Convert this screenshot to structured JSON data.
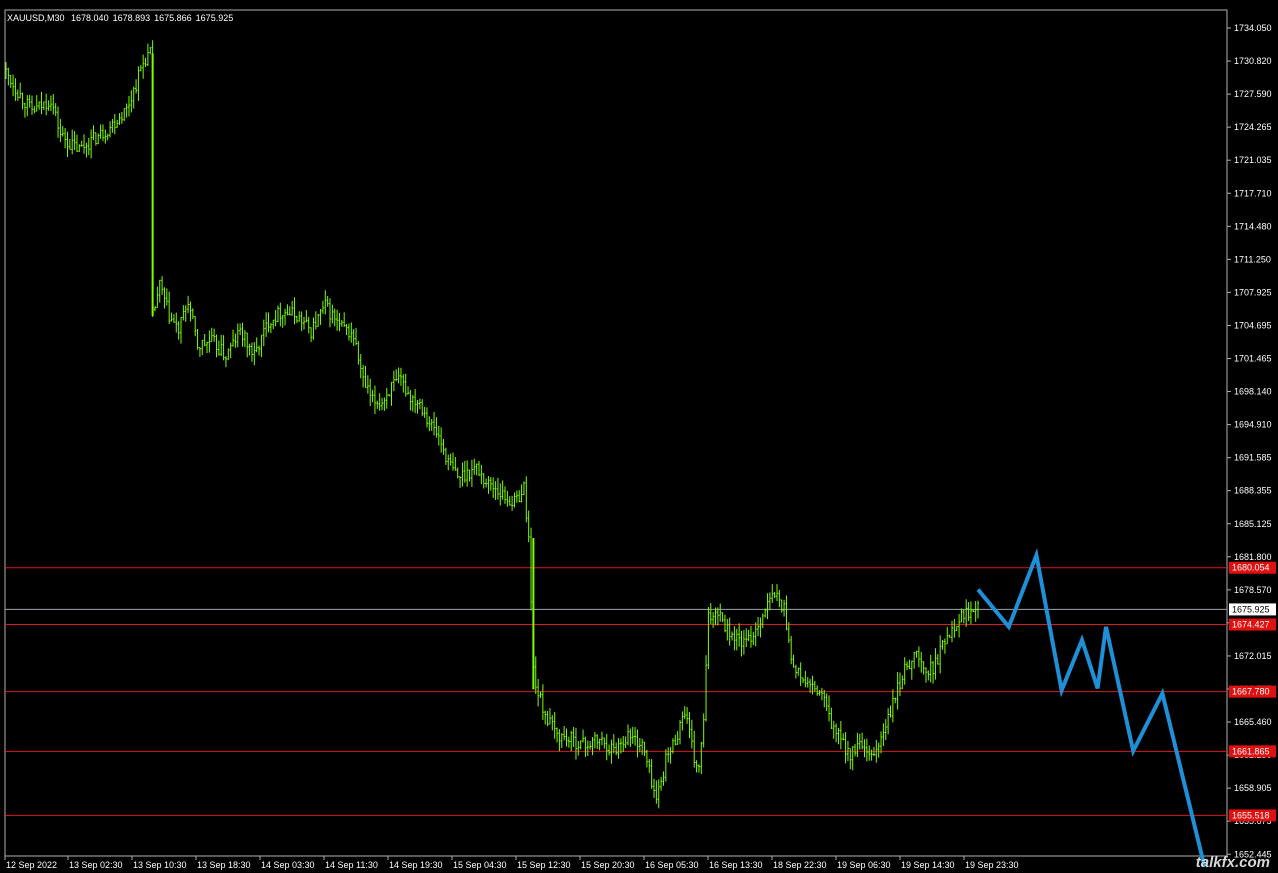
{
  "header": {
    "symbol": "XAUUSD,M30",
    "open": "1678.040",
    "high": "1678.893",
    "low": "1675.866",
    "close": "1675.925"
  },
  "watermark": "talkfx.com",
  "chart_data": {
    "type": "candlestick",
    "price_axis": {
      "ylim": [
        1651.5,
        1735.3
      ],
      "ticks": [
        "1734.050",
        "1730.820",
        "1727.590",
        "1724.265",
        "1721.035",
        "1717.710",
        "1714.480",
        "1711.250",
        "1707.925",
        "1704.695",
        "1701.465",
        "1698.140",
        "1694.910",
        "1691.585",
        "1688.355",
        "1685.125",
        "1681.800",
        "1678.570",
        "1675.245",
        "1672.015",
        "1668.785",
        "1665.460",
        "1662.230",
        "1658.905",
        "1655.675",
        "1652.445"
      ]
    },
    "time_axis": {
      "labels": [
        "12 Sep 2022",
        "13 Sep 02:30",
        "13 Sep 10:30",
        "13 Sep 18:30",
        "14 Sep 03:30",
        "14 Sep 11:30",
        "14 Sep 19:30",
        "15 Sep 04:30",
        "15 Sep 12:30",
        "15 Sep 20:30",
        "16 Sep 05:30",
        "16 Sep 13:30",
        "18 Sep 22:30",
        "19 Sep 06:30",
        "19 Sep 14:30",
        "19 Sep 23:30"
      ]
    },
    "current_price": "1675.925",
    "levels": [
      {
        "label": "1680.054",
        "value": 1680.054
      },
      {
        "label": "1674.427",
        "value": 1674.427
      },
      {
        "label": "1667.780",
        "value": 1667.78
      },
      {
        "label": "1661.865",
        "value": 1661.865
      },
      {
        "label": "1655.518",
        "value": 1655.518
      }
    ],
    "price_path": [
      [
        0,
        1729.5
      ],
      [
        4,
        1728.0
      ],
      [
        8,
        1726.5
      ],
      [
        12,
        1725.3
      ],
      [
        16,
        1725.8
      ],
      [
        20,
        1726.5
      ],
      [
        24,
        1723.0
      ],
      [
        28,
        1722.0
      ],
      [
        32,
        1721.5
      ],
      [
        36,
        1722.2
      ],
      [
        40,
        1722.8
      ],
      [
        44,
        1723.5
      ],
      [
        48,
        1724.5
      ],
      [
        52,
        1725.5
      ],
      [
        56,
        1728.0
      ],
      [
        58,
        1729.5
      ],
      [
        60,
        1730.5
      ],
      [
        62,
        1731.0
      ],
      [
        63,
        1705.0
      ],
      [
        66,
        1708.0
      ],
      [
        70,
        1705.0
      ],
      [
        74,
        1703.5
      ],
      [
        78,
        1706.5
      ],
      [
        82,
        1702.0
      ],
      [
        88,
        1702.5
      ],
      [
        94,
        1701.0
      ],
      [
        100,
        1703.5
      ],
      [
        106,
        1701.0
      ],
      [
        112,
        1704.5
      ],
      [
        118,
        1705.5
      ],
      [
        124,
        1705.0
      ],
      [
        130,
        1703.5
      ],
      [
        136,
        1706.0
      ],
      [
        142,
        1704.0
      ],
      [
        148,
        1703.0
      ],
      [
        152,
        1698.5
      ],
      [
        156,
        1696.5
      ],
      [
        160,
        1696.5
      ],
      [
        164,
        1698.0
      ],
      [
        168,
        1698.5
      ],
      [
        172,
        1697.0
      ],
      [
        176,
        1696.5
      ],
      [
        180,
        1694.5
      ],
      [
        184,
        1693.0
      ],
      [
        188,
        1690.5
      ],
      [
        192,
        1689.0
      ],
      [
        196,
        1689.5
      ],
      [
        200,
        1690.0
      ],
      [
        204,
        1688.5
      ],
      [
        208,
        1688.0
      ],
      [
        212,
        1687.0
      ],
      [
        216,
        1686.5
      ],
      [
        220,
        1688.0
      ],
      [
        222,
        1683.0
      ],
      [
        224,
        1670.0
      ],
      [
        226,
        1667.5
      ],
      [
        230,
        1665.0
      ],
      [
        234,
        1663.5
      ],
      [
        240,
        1663.0
      ],
      [
        246,
        1662.5
      ],
      [
        252,
        1663.0
      ],
      [
        258,
        1662.0
      ],
      [
        264,
        1663.5
      ],
      [
        270,
        1662.5
      ],
      [
        274,
        1659.0
      ],
      [
        276,
        1657.0
      ],
      [
        280,
        1661.0
      ],
      [
        284,
        1663.0
      ],
      [
        288,
        1666.0
      ],
      [
        292,
        1661.0
      ],
      [
        294,
        1660.0
      ],
      [
        296,
        1665.0
      ],
      [
        298,
        1675.0
      ],
      [
        302,
        1676.0
      ],
      [
        306,
        1674.0
      ],
      [
        310,
        1673.0
      ],
      [
        314,
        1672.5
      ],
      [
        318,
        1674.0
      ],
      [
        322,
        1676.0
      ],
      [
        326,
        1677.5
      ],
      [
        330,
        1676.0
      ],
      [
        334,
        1670.0
      ],
      [
        338,
        1669.0
      ],
      [
        342,
        1668.0
      ],
      [
        346,
        1667.5
      ],
      [
        350,
        1664.5
      ],
      [
        354,
        1663.0
      ],
      [
        358,
        1661.5
      ],
      [
        362,
        1662.5
      ],
      [
        366,
        1661.0
      ],
      [
        370,
        1662.5
      ],
      [
        374,
        1665.0
      ],
      [
        378,
        1668.0
      ],
      [
        382,
        1670.5
      ],
      [
        386,
        1671.5
      ],
      [
        390,
        1669.5
      ],
      [
        394,
        1670.5
      ],
      [
        398,
        1673.0
      ],
      [
        402,
        1674.5
      ],
      [
        406,
        1675.5
      ],
      [
        410,
        1676.0
      ],
      [
        412,
        1677.0
      ]
    ],
    "forecast": [
      [
        0,
        1677.9
      ],
      [
        7.7,
        1674.2
      ],
      [
        14.6,
        1681.3
      ],
      [
        20.9,
        1667.9
      ],
      [
        26.0,
        1672.9
      ],
      [
        29.9,
        1668.1
      ],
      [
        32.0,
        1674.2
      ],
      [
        38.8,
        1661.9
      ],
      [
        46.1,
        1667.6
      ],
      [
        56.6,
        1650.5
      ]
    ]
  }
}
